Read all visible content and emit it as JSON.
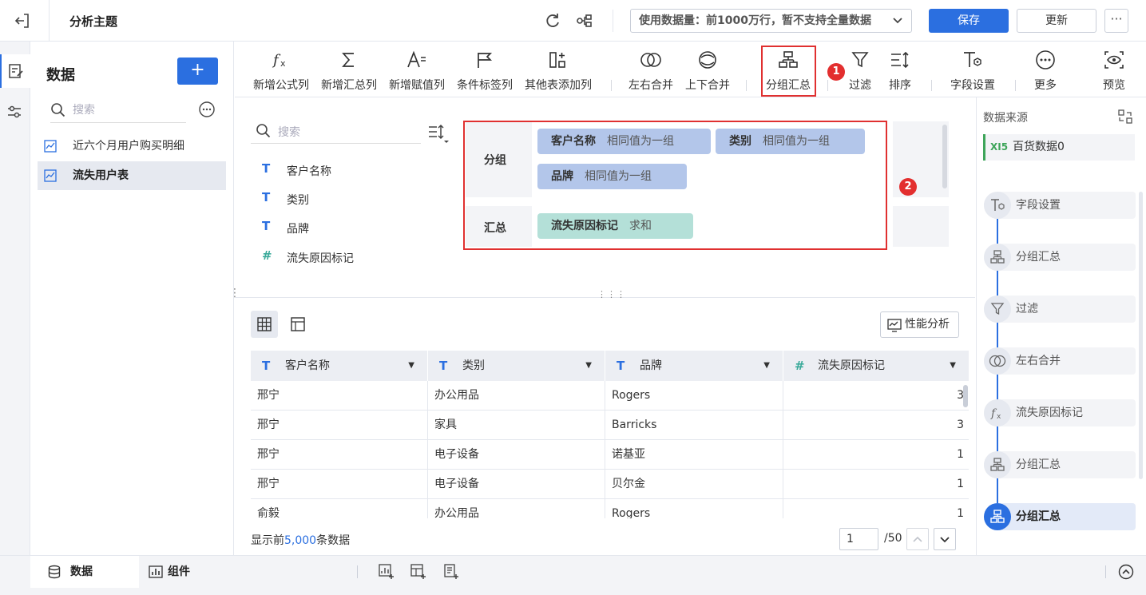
{
  "header": {
    "title": "分析主题",
    "usage_label": "使用数据量：前1000万行，暂不支持全量数据",
    "save_label": "保存",
    "update_label": "更新",
    "more_label": "···"
  },
  "data_panel": {
    "title": "数据",
    "add_label": "+",
    "search_placeholder": "搜索",
    "items": [
      {
        "label": "近六个月用户购买明细"
      },
      {
        "label": "流失用户表"
      }
    ]
  },
  "toolbar": {
    "items": [
      {
        "label": "新增公式列",
        "icon": "formula-icon"
      },
      {
        "label": "新增汇总列",
        "icon": "sigma-icon"
      },
      {
        "label": "新增赋值列",
        "icon": "assign-icon"
      },
      {
        "label": "条件标签列",
        "icon": "flag-icon"
      },
      {
        "label": "其他表添加列",
        "icon": "add-column-icon"
      },
      {
        "label": "左右合并",
        "icon": "merge-lr-icon"
      },
      {
        "label": "上下合并",
        "icon": "merge-ud-icon"
      },
      {
        "label": "分组汇总",
        "icon": "group-summary-icon"
      },
      {
        "label": "过滤",
        "icon": "filter-icon"
      },
      {
        "label": "排序",
        "icon": "sort-icon"
      },
      {
        "label": "字段设置",
        "icon": "field-settings-icon"
      },
      {
        "label": "更多",
        "icon": "more-icon"
      },
      {
        "label": "预览",
        "icon": "preview-icon"
      }
    ],
    "badge1": "1",
    "badge2": "2"
  },
  "fields": {
    "search_placeholder": "搜索",
    "items": [
      {
        "type_glyph": "T",
        "name": "客户名称"
      },
      {
        "type_glyph": "T",
        "name": "类别"
      },
      {
        "type_glyph": "T",
        "name": "品牌"
      },
      {
        "type_glyph": "#",
        "name": "流失原因标记"
      }
    ]
  },
  "group_config": {
    "group_label": "分组",
    "summary_label": "汇总",
    "group_chips": [
      {
        "name": "客户名称",
        "mode": "相同值为一组"
      },
      {
        "name": "类别",
        "mode": "相同值为一组"
      },
      {
        "name": "品牌",
        "mode": "相同值为一组"
      }
    ],
    "summary_chips": [
      {
        "name": "流失原因标记",
        "mode": "求和"
      }
    ]
  },
  "table": {
    "perf_label": "性能分析",
    "columns": [
      {
        "glyph": "T",
        "name": "客户名称"
      },
      {
        "glyph": "T",
        "name": "类别"
      },
      {
        "glyph": "T",
        "name": "品牌"
      },
      {
        "glyph": "#",
        "name": "流失原因标记"
      }
    ],
    "rows": [
      [
        "邢宁",
        "办公用品",
        "Rogers",
        "3"
      ],
      [
        "邢宁",
        "家具",
        "Barricks",
        "3"
      ],
      [
        "邢宁",
        "电子设备",
        "诺基亚",
        "1"
      ],
      [
        "邢宁",
        "电子设备",
        "贝尔金",
        "1"
      ],
      [
        "俞毅",
        "办公用品",
        "Rogers",
        "1"
      ]
    ],
    "footer_prefix": "显示前",
    "footer_count": "5,000",
    "footer_suffix": "条数据",
    "page_current": "1",
    "page_total": "/50"
  },
  "steps": {
    "source_title": "数据来源",
    "source_item": "百货数据0",
    "source_glyph": "XI5",
    "items": [
      {
        "label": "字段设置",
        "icon": "field-settings-icon"
      },
      {
        "label": "分组汇总",
        "icon": "group-summary-icon"
      },
      {
        "label": "过滤",
        "icon": "filter-icon"
      },
      {
        "label": "左右合并",
        "icon": "merge-lr-icon"
      },
      {
        "label": "流失原因标记",
        "icon": "formula-icon"
      },
      {
        "label": "分组汇总",
        "icon": "group-summary-icon"
      },
      {
        "label": "分组汇总",
        "icon": "group-summary-icon"
      }
    ]
  },
  "bottom": {
    "tab_data": "数据",
    "tab_component": "组件"
  },
  "colors": {
    "accent": "#2b6fe0",
    "highlight_box": "#e03030",
    "chip_group": "#b3c6ea",
    "chip_summary": "#b4e0d8"
  }
}
